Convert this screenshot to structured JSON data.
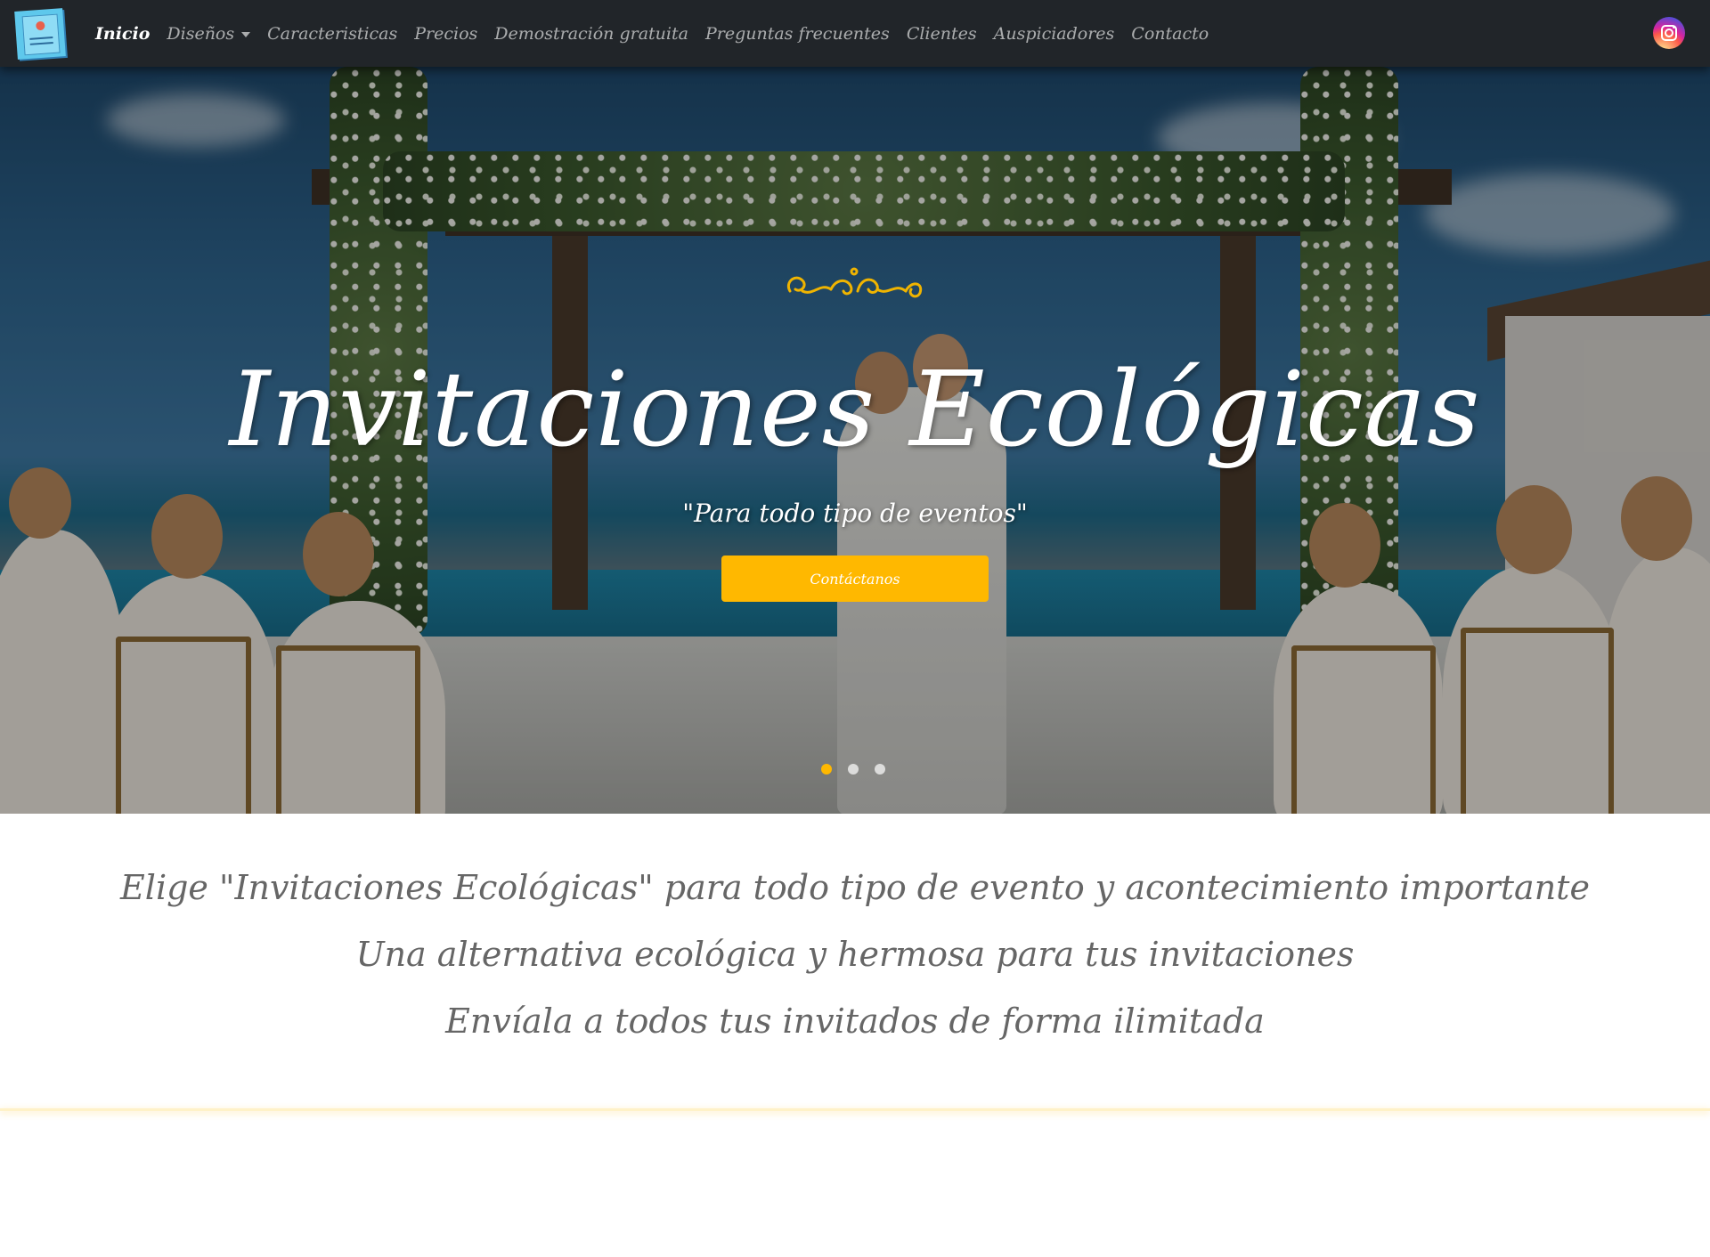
{
  "navbar": {
    "logo_icon": "brand-logo",
    "links": [
      {
        "label": "Inicio",
        "active": true
      },
      {
        "label": "Diseños",
        "dropdown": true
      },
      {
        "label": "Caracteristicas"
      },
      {
        "label": "Precios"
      },
      {
        "label": "Demostración gratuita"
      },
      {
        "label": "Preguntas frecuentes"
      },
      {
        "label": "Clientes"
      },
      {
        "label": "Auspiciadores"
      },
      {
        "label": "Contacto"
      }
    ],
    "social_icon": "instagram-icon"
  },
  "hero": {
    "title": "Invitaciones Ecológicas",
    "subtitle": "\"Para todo tipo de eventos\"",
    "cta_label": "Contáctanos",
    "slides_count": 3,
    "active_slide": 1,
    "accent_color": "#ffb800"
  },
  "taglines": [
    "Elige \"Invitaciones Ecológicas\" para todo tipo de evento y acontecimiento importante",
    "Una alternativa ecológica y hermosa para tus invitaciones",
    "Envíala a todos tus invitados de forma ilimitada"
  ],
  "colors": {
    "navbar_bg": "#212529",
    "tagline_text": "#666666",
    "cta_bg": "#ffb800"
  }
}
